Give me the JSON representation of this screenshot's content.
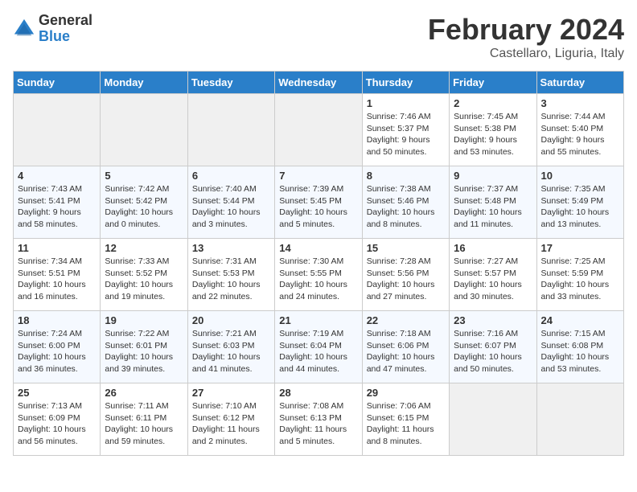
{
  "logo": {
    "general": "General",
    "blue": "Blue"
  },
  "title": "February 2024",
  "location": "Castellaro, Liguria, Italy",
  "days_header": [
    "Sunday",
    "Monday",
    "Tuesday",
    "Wednesday",
    "Thursday",
    "Friday",
    "Saturday"
  ],
  "weeks": [
    [
      {
        "day": "",
        "empty": true
      },
      {
        "day": "",
        "empty": true
      },
      {
        "day": "",
        "empty": true
      },
      {
        "day": "",
        "empty": true
      },
      {
        "day": "1",
        "sunrise": "7:46 AM",
        "sunset": "5:37 PM",
        "daylight": "9 hours and 50 minutes."
      },
      {
        "day": "2",
        "sunrise": "7:45 AM",
        "sunset": "5:38 PM",
        "daylight": "9 hours and 53 minutes."
      },
      {
        "day": "3",
        "sunrise": "7:44 AM",
        "sunset": "5:40 PM",
        "daylight": "9 hours and 55 minutes."
      }
    ],
    [
      {
        "day": "4",
        "sunrise": "7:43 AM",
        "sunset": "5:41 PM",
        "daylight": "9 hours and 58 minutes."
      },
      {
        "day": "5",
        "sunrise": "7:42 AM",
        "sunset": "5:42 PM",
        "daylight": "10 hours and 0 minutes."
      },
      {
        "day": "6",
        "sunrise": "7:40 AM",
        "sunset": "5:44 PM",
        "daylight": "10 hours and 3 minutes."
      },
      {
        "day": "7",
        "sunrise": "7:39 AM",
        "sunset": "5:45 PM",
        "daylight": "10 hours and 5 minutes."
      },
      {
        "day": "8",
        "sunrise": "7:38 AM",
        "sunset": "5:46 PM",
        "daylight": "10 hours and 8 minutes."
      },
      {
        "day": "9",
        "sunrise": "7:37 AM",
        "sunset": "5:48 PM",
        "daylight": "10 hours and 11 minutes."
      },
      {
        "day": "10",
        "sunrise": "7:35 AM",
        "sunset": "5:49 PM",
        "daylight": "10 hours and 13 minutes."
      }
    ],
    [
      {
        "day": "11",
        "sunrise": "7:34 AM",
        "sunset": "5:51 PM",
        "daylight": "10 hours and 16 minutes."
      },
      {
        "day": "12",
        "sunrise": "7:33 AM",
        "sunset": "5:52 PM",
        "daylight": "10 hours and 19 minutes."
      },
      {
        "day": "13",
        "sunrise": "7:31 AM",
        "sunset": "5:53 PM",
        "daylight": "10 hours and 22 minutes."
      },
      {
        "day": "14",
        "sunrise": "7:30 AM",
        "sunset": "5:55 PM",
        "daylight": "10 hours and 24 minutes."
      },
      {
        "day": "15",
        "sunrise": "7:28 AM",
        "sunset": "5:56 PM",
        "daylight": "10 hours and 27 minutes."
      },
      {
        "day": "16",
        "sunrise": "7:27 AM",
        "sunset": "5:57 PM",
        "daylight": "10 hours and 30 minutes."
      },
      {
        "day": "17",
        "sunrise": "7:25 AM",
        "sunset": "5:59 PM",
        "daylight": "10 hours and 33 minutes."
      }
    ],
    [
      {
        "day": "18",
        "sunrise": "7:24 AM",
        "sunset": "6:00 PM",
        "daylight": "10 hours and 36 minutes."
      },
      {
        "day": "19",
        "sunrise": "7:22 AM",
        "sunset": "6:01 PM",
        "daylight": "10 hours and 39 minutes."
      },
      {
        "day": "20",
        "sunrise": "7:21 AM",
        "sunset": "6:03 PM",
        "daylight": "10 hours and 41 minutes."
      },
      {
        "day": "21",
        "sunrise": "7:19 AM",
        "sunset": "6:04 PM",
        "daylight": "10 hours and 44 minutes."
      },
      {
        "day": "22",
        "sunrise": "7:18 AM",
        "sunset": "6:06 PM",
        "daylight": "10 hours and 47 minutes."
      },
      {
        "day": "23",
        "sunrise": "7:16 AM",
        "sunset": "6:07 PM",
        "daylight": "10 hours and 50 minutes."
      },
      {
        "day": "24",
        "sunrise": "7:15 AM",
        "sunset": "6:08 PM",
        "daylight": "10 hours and 53 minutes."
      }
    ],
    [
      {
        "day": "25",
        "sunrise": "7:13 AM",
        "sunset": "6:09 PM",
        "daylight": "10 hours and 56 minutes."
      },
      {
        "day": "26",
        "sunrise": "7:11 AM",
        "sunset": "6:11 PM",
        "daylight": "10 hours and 59 minutes."
      },
      {
        "day": "27",
        "sunrise": "7:10 AM",
        "sunset": "6:12 PM",
        "daylight": "11 hours and 2 minutes."
      },
      {
        "day": "28",
        "sunrise": "7:08 AM",
        "sunset": "6:13 PM",
        "daylight": "11 hours and 5 minutes."
      },
      {
        "day": "29",
        "sunrise": "7:06 AM",
        "sunset": "6:15 PM",
        "daylight": "11 hours and 8 minutes."
      },
      {
        "day": "",
        "empty": true
      },
      {
        "day": "",
        "empty": true
      }
    ]
  ],
  "labels": {
    "sunrise_prefix": "Sunrise: ",
    "sunset_prefix": "Sunset: ",
    "daylight_prefix": "Daylight: "
  }
}
